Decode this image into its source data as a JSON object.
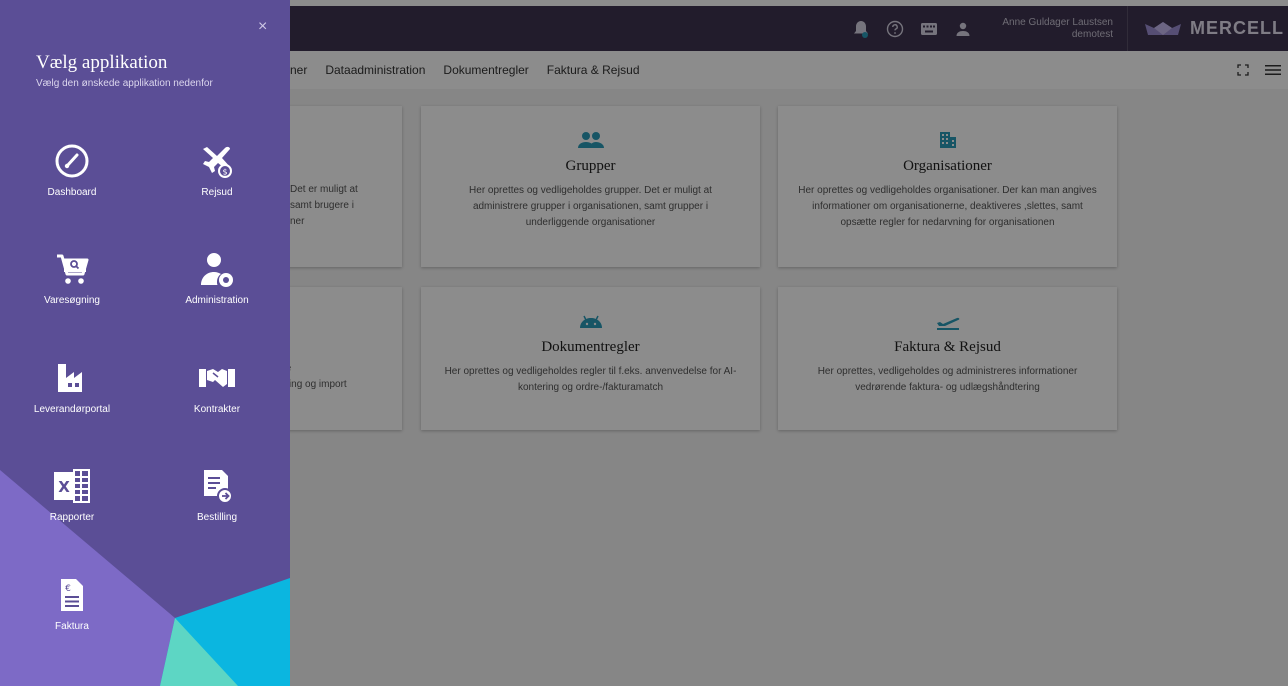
{
  "header": {
    "user_name": "Anne Guldager Laustsen",
    "user_org": "demotest",
    "brand": "MERCELL"
  },
  "subnav": {
    "items": [
      "ner",
      "Dataadministration",
      "Dokumentregler",
      "Faktura & Rejsud"
    ]
  },
  "cards": [
    {
      "title": "Grupper",
      "desc": "Her oprettes og vedligeholdes grupper. Det er muligt at administrere grupper i organisationen, samt grupper i underliggende organisationer",
      "icon": "group-icon"
    },
    {
      "title": "Organisationer",
      "desc": "Her oprettes og vedligeholdes organisationer. Der kan man angives informationer om organisationerne, deaktiveres ,slettes, samt opsætte regler for nedarvning for organisationen",
      "icon": "building-icon"
    },
    {
      "title": "Dokumentregler",
      "desc": "Her oprettes og vedligeholdes regler til f.eks. anvenvedelse for AI-kontering og ordre-/fakturamatch",
      "icon": "android-icon"
    },
    {
      "title": "Faktura & Rejsud",
      "desc": "Her oprettes, vedligeholdes og administreres informationer vedrørende faktura- og udlægshåndtering",
      "icon": "plane-departure-icon"
    }
  ],
  "partial_cards": {
    "left1_lines": [
      "Det er muligt at",
      "samt brugere i",
      "ner"
    ],
    "left2_title": "n",
    "left2_lines": [
      "elige",
      "ejdning og import"
    ]
  },
  "drawer": {
    "title": "Vælg applikation",
    "subtitle": "Vælg den ønskede applikation nedenfor",
    "close": "×",
    "apps": [
      {
        "label": "Dashboard",
        "icon": "dashboard-gauge-icon"
      },
      {
        "label": "Rejsud",
        "icon": "travel-expense-icon"
      },
      {
        "label": "Varesøgning",
        "icon": "cart-search-icon"
      },
      {
        "label": "Administration",
        "icon": "user-settings-icon"
      },
      {
        "label": "Leverandørportal",
        "icon": "factory-icon"
      },
      {
        "label": "Kontrakter",
        "icon": "handshake-icon"
      },
      {
        "label": "Rapporter",
        "icon": "excel-icon"
      },
      {
        "label": "Bestilling",
        "icon": "order-form-icon"
      },
      {
        "label": "Faktura",
        "icon": "invoice-euro-icon"
      }
    ]
  },
  "colors": {
    "topbar": "#3e3450",
    "drawer": "#5b4e96",
    "accent_teal": "#2a9bb8",
    "deco_cyan": "#0bb6e0",
    "deco_mint": "#5dd6c4",
    "deco_lilac": "#7d6ac6"
  }
}
